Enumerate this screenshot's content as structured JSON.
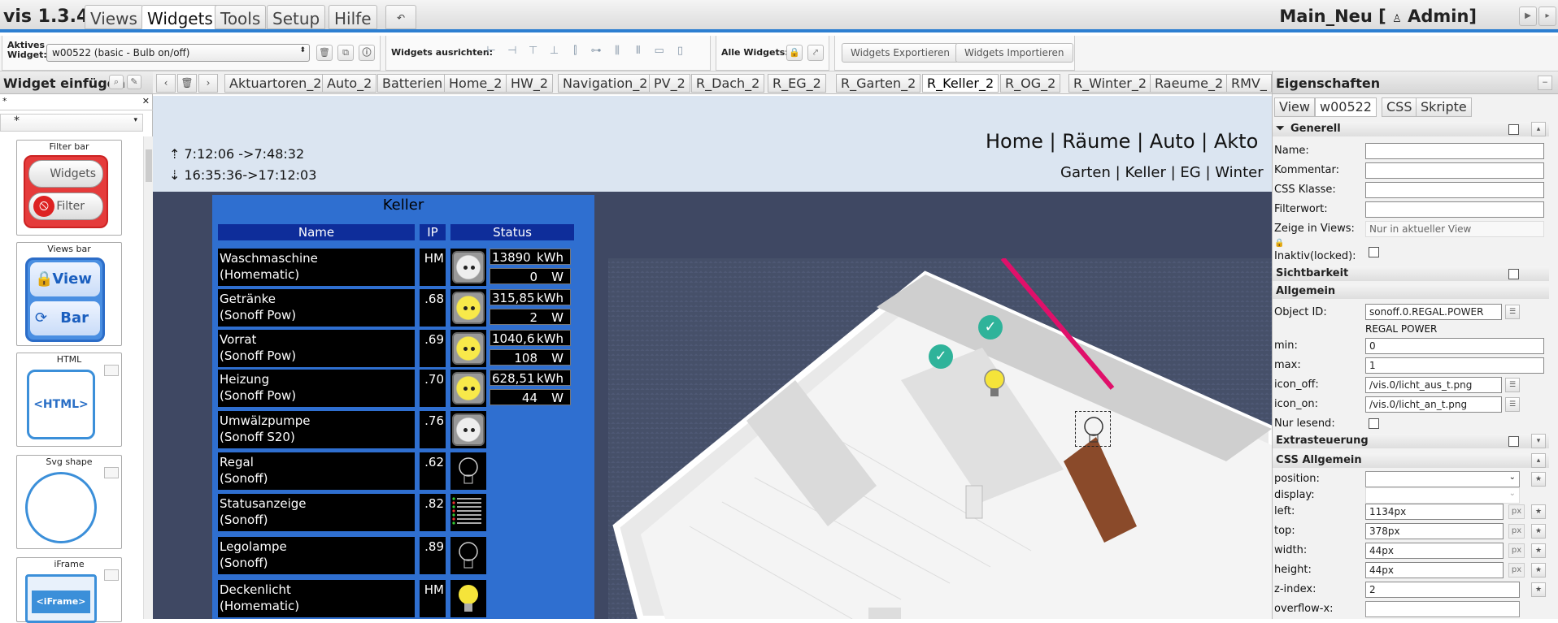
{
  "app": {
    "title": "vis 1.3.4",
    "project": "Main_Neu [",
    "user": "Admin]"
  },
  "menu": [
    "Views",
    "Widgets",
    "Tools",
    "Setup",
    "Hilfe"
  ],
  "toolbar": {
    "active_widget_label_1": "Aktives",
    "active_widget_label_2": "Widget:",
    "active_widget_value": "w00522 (basic - Bulb on/off)",
    "align_label": "Widgets ausrichten:",
    "all_widgets_label": "Alle Widgets:",
    "export_label": "Widgets Exportieren",
    "import_label": "Widgets Importieren"
  },
  "left_panel": {
    "title": "Widget einfügen",
    "filter_value": "*",
    "set_value": "*",
    "cards": [
      {
        "title": "Filter bar",
        "btn1": "Widgets",
        "btn2": "Filter"
      },
      {
        "title": "Views bar",
        "btn1": "View",
        "btn2": "Bar"
      },
      {
        "title": "HTML",
        "inner": "<HTML>"
      },
      {
        "title": "Svg shape"
      },
      {
        "title": "iFrame",
        "inner": "<iFrame>"
      }
    ]
  },
  "view_tabs": [
    "Aktuartoren_2",
    "Auto_2",
    "Batterien",
    "Home_2",
    "HW_2",
    "Navigation_2",
    "PV_2",
    "R_Dach_2",
    "R_EG_2",
    "R_Garten_2",
    "R_Keller_2",
    "R_OG_2",
    "R_Winter_2",
    "Raeume_2",
    "RMV_"
  ],
  "active_view": "R_Keller_2",
  "view": {
    "sunrise": "7:12:06 ->7:48:32",
    "sunset": "16:35:36->17:12:03",
    "nav": [
      "Home",
      "Räume",
      "Auto",
      "Akto"
    ],
    "subnav": [
      "Garten",
      "Keller",
      "EG",
      "Winter"
    ],
    "panel_title": "Keller",
    "headers": {
      "name": "Name",
      "ip": "IP",
      "status": "Status"
    },
    "rows": [
      {
        "name1": "Waschmaschine",
        "name2": "(Homematic)",
        "ip": "HM",
        "icon": "socket-off",
        "kwh": "13890",
        "w": "0"
      },
      {
        "name1": "Getränke",
        "name2": "(Sonoff Pow)",
        "ip": ".68",
        "icon": "socket-on",
        "kwh": "315,85",
        "w": "2"
      },
      {
        "name1": "Vorrat",
        "name2": "(Sonoff Pow)",
        "ip": ".69",
        "icon": "socket-on",
        "kwh": "1040,6",
        "w": "108"
      },
      {
        "name1": "Heizung",
        "name2": "(Sonoff Pow)",
        "ip": ".70",
        "icon": "socket-on",
        "kwh": "628,51",
        "w": "44"
      },
      {
        "name1": "Umwälzpumpe",
        "name2": "(Sonoff S20)",
        "ip": ".76",
        "icon": "socket-off"
      },
      {
        "name1": "Regal",
        "name2": "(Sonoff)",
        "ip": ".62",
        "icon": "bulb-off"
      },
      {
        "name1": "Statusanzeige",
        "name2": "(Sonoff)",
        "ip": ".82",
        "icon": "status-list"
      },
      {
        "name1": "Legolampe",
        "name2": "(Sonoff)",
        "ip": ".89",
        "icon": "bulb-off"
      },
      {
        "name1": "Deckenlicht",
        "name2": "(Homematic)",
        "ip": "HM",
        "icon": "bulb-on"
      }
    ],
    "unit_kwh": "kWh",
    "unit_w": "W"
  },
  "right_panel": {
    "title": "Eigenschaften",
    "tabs": [
      "View",
      "w00522",
      "CSS",
      "Skripte"
    ],
    "active_tab": "w00522",
    "sections": {
      "generell": "Generell",
      "sichtbarkeit": "Sichtbarkeit",
      "allgemein": "Allgemein",
      "extrasteuerung": "Extrasteuerung",
      "css_allgemein": "CSS Allgemein"
    },
    "fields": {
      "name": "Name:",
      "kommentar": "Kommentar:",
      "css_klasse": "CSS Klasse:",
      "filterwort": "Filterwort:",
      "zeige_in_views": "Zeige in Views:",
      "zeige_in_views_value": "Nur in aktueller View",
      "inaktiv": "Inaktiv(locked):",
      "object_id": "Object ID:",
      "object_id_value": "sonoff.0.REGAL.POWER",
      "object_id_name": "REGAL POWER",
      "min": "min:",
      "min_value": "0",
      "max": "max:",
      "max_value": "1",
      "icon_off": "icon_off:",
      "icon_off_value": "/vis.0/licht_aus_t.png",
      "icon_on": "icon_on:",
      "icon_on_value": "/vis.0/licht_an_t.png",
      "nur_lesend": "Nur lesend:",
      "position": "position:",
      "display": "display:",
      "left": "left:",
      "left_value": "1134px",
      "top": "top:",
      "top_value": "378px",
      "width": "width:",
      "width_value": "44px",
      "height": "height:",
      "height_value": "44px",
      "zindex": "z-index:",
      "zindex_value": "2",
      "overflow_x": "overflow-x:",
      "px": "px"
    }
  }
}
